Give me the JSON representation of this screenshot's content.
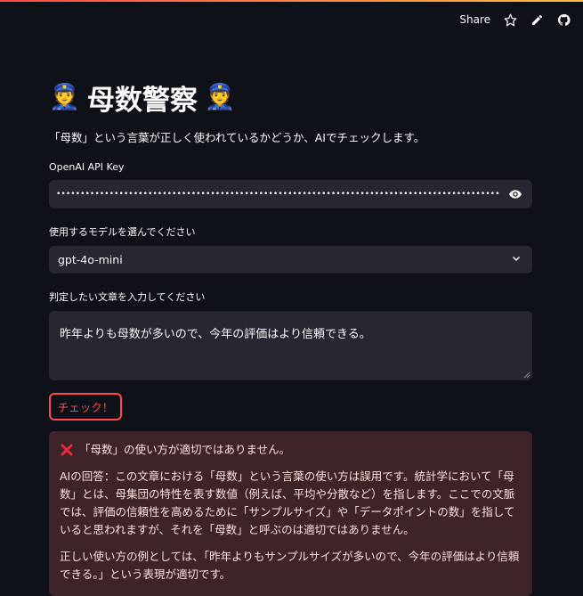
{
  "topbar": {
    "share_label": "Share"
  },
  "app": {
    "title": "母数警察",
    "caption": "「母数」という言葉が正しく使われているかどうか、AIでチェックします。"
  },
  "api_key": {
    "label": "OpenAI API Key",
    "masked_value": "••••••••••••••••••••••••••••••••••••••••••••••••••••••••••••••••••••••••••••••••••••••••••••••••••••••••••••••••••••••••••••••••"
  },
  "model": {
    "label": "使用するモデルを選んでください",
    "selected": "gpt-4o-mini"
  },
  "text_input": {
    "label": "判定したい文章を入力してください",
    "value": "昨年よりも母数が多いので、今年の評価はより信頼できる。"
  },
  "check_button": {
    "label": "チェック！"
  },
  "result": {
    "heading": "「母数」の使い方が適切ではありません。",
    "paragraph1": "AIの回答：この文章における「母数」という言葉の使い方は誤用です。統計学において「母数」とは、母集団の特性を表す数値（例えば、平均や分散など）を指します。ここでの文脈では、評価の信頼性を高めるために「サンプルサイズ」や「データポイントの数」を指していると思われますが、それを「母数」と呼ぶのは適切ではありません。",
    "paragraph2": "正しい使い方の例としては、「昨年よりもサンプルサイズが多いので、今年の評価はより信頼できる。」という表現が適切です。"
  },
  "colors": {
    "background": "#0e1117",
    "input_bg": "#262730",
    "accent": "#ff4b4b",
    "error_bg": "#3e2428",
    "error_text": "#ffdede"
  }
}
